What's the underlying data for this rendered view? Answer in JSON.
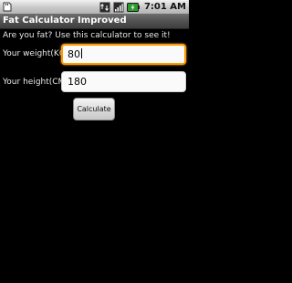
{
  "status_bar": {
    "time": "7:01 AM",
    "left_icon": "sd-card-icon",
    "right_icons": [
      "network-data-icon",
      "signal-icon",
      "battery-charging-icon"
    ]
  },
  "title_bar": {
    "title": "Fat Calculator Improved"
  },
  "main": {
    "intro": "Are you fat? Use this calculator to see it!",
    "weight_label": "Your weight(KG)",
    "weight_value": "80",
    "height_label": "Your height(CM)",
    "height_value": "180",
    "calculate_label": "Calculate"
  },
  "colors": {
    "focus_border": "#ff9a00",
    "background": "#000000"
  }
}
